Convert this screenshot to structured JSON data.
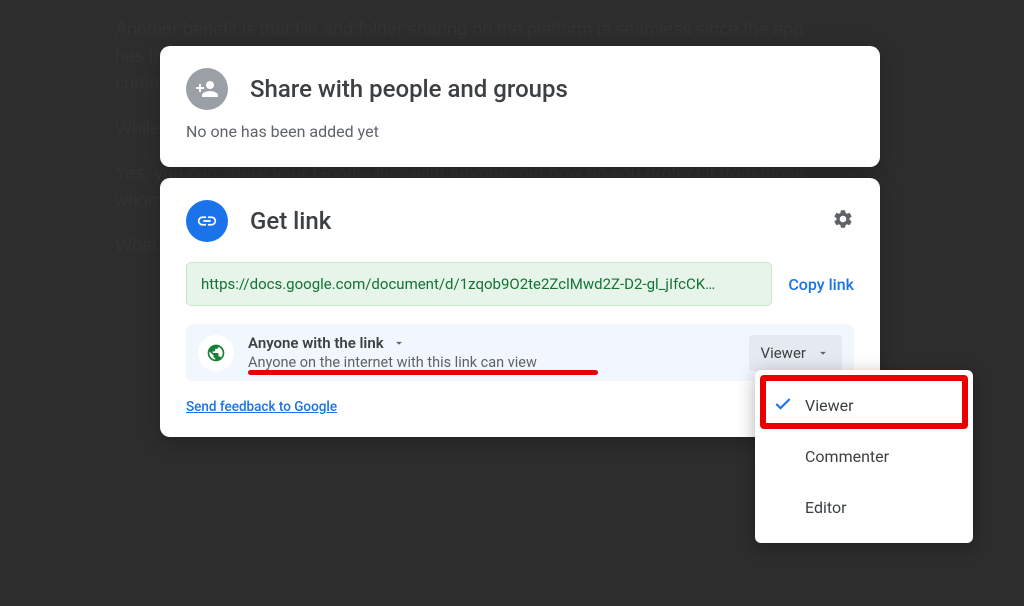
{
  "background_paragraphs": [
    "Another benefit is that file and folder sharing on the platform is seamless since the app has this fantastic ability to share files with others. You can allow them access to view, comment, or edit the file by",
    "While drawb",
    "Yes, you can share your Google files with anyone, but how do you protect it from those whom you do",
    "What"
  ],
  "share_card": {
    "title": "Share with people and groups",
    "subtitle": "No one has been added yet"
  },
  "link_card": {
    "title": "Get link",
    "url": "https://docs.google.com/document/d/1zqob9O2te2ZclMwd2Z-D2-gl_jIfcCK…",
    "copy_label": "Copy link",
    "access_heading": "Anyone with the link",
    "access_desc": "Anyone on the internet with this link can view",
    "role_label": "Viewer",
    "feedback": "Send feedback to Google"
  },
  "dropdown": {
    "items": [
      {
        "label": "Viewer",
        "selected": true
      },
      {
        "label": "Commenter",
        "selected": false
      },
      {
        "label": "Editor",
        "selected": false
      }
    ]
  }
}
